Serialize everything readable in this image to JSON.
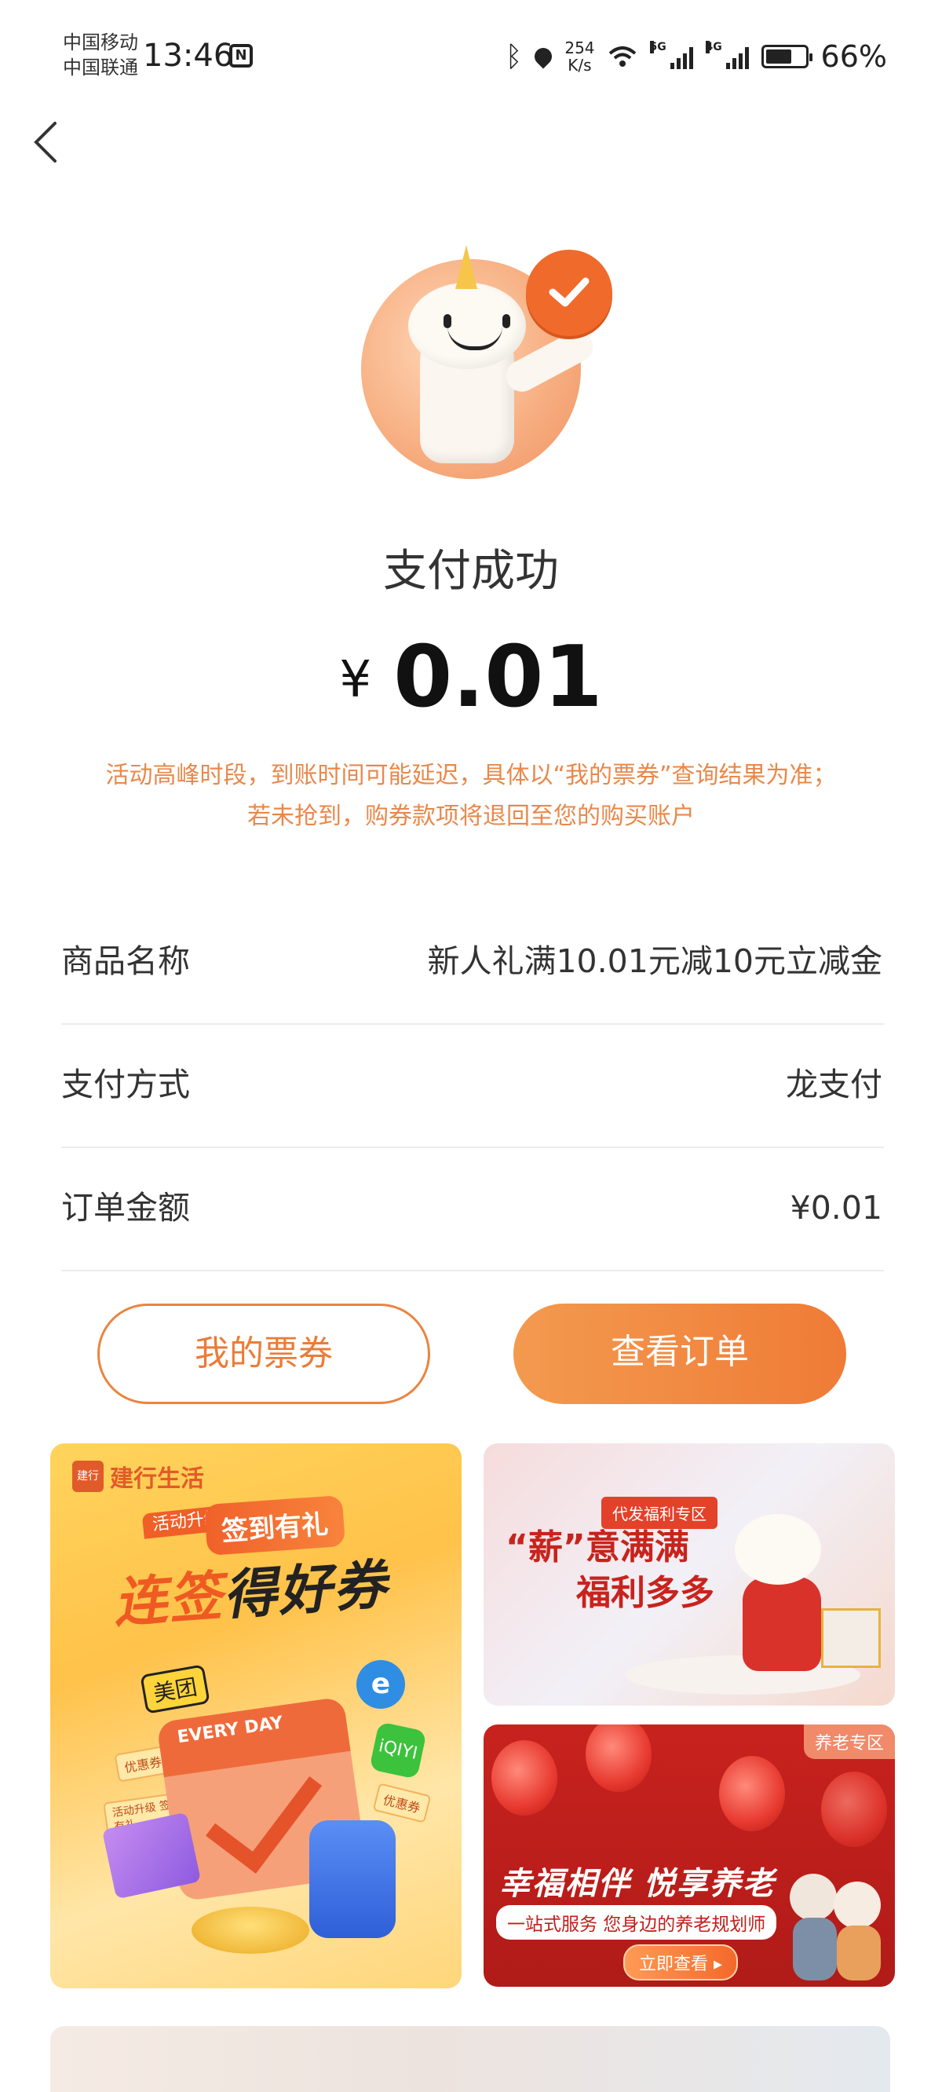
{
  "status_bar": {
    "carrier_1": "中国移动",
    "carrier_2": "中国联通",
    "time": "13:46",
    "nfc": "N",
    "net_speed_value": "254",
    "net_speed_unit": "K/s",
    "sig_1_tag": "5G",
    "sig_2_tag": "4G",
    "battery": "66%"
  },
  "result": {
    "title": "支付成功",
    "currency": "¥",
    "amount": "0.01",
    "notice_line1": "活动高峰时段，到账时间可能延迟，具体以“我的票券”查询结果为准；",
    "notice_line2": "若未抢到，购券款项将退回至您的购买账户"
  },
  "details": [
    {
      "label": "商品名称",
      "value": "新人礼满10.01元减10元立减金"
    },
    {
      "label": "支付方式",
      "value": "龙支付"
    },
    {
      "label": "订单金额",
      "value": "¥0.01"
    }
  ],
  "actions": {
    "my_tickets": "我的票券",
    "view_order": "查看订单"
  },
  "banners": {
    "signin": {
      "brand": "建行生活",
      "logo_text": "建行",
      "tag": "活动升级",
      "sub": "签到有礼",
      "head_1": "连签",
      "head_2": "得好券",
      "meituan": "美团",
      "calendar": "EVERY DAY",
      "e_icon": "e",
      "iqiyi": "iQIYI",
      "ticket_1": "优惠券",
      "ticket_2": "优惠券",
      "ticket_3": "活动升级 签到有礼"
    },
    "salary": {
      "tag": "代发福利专区",
      "head_1": "“薪”意满满",
      "head_2": "福利多多"
    },
    "elder": {
      "tag": "养老专区",
      "head": "幸福相伴 悦享养老",
      "sub": "一站式服务 您身边的养老规划师",
      "button": "立即查看 ▸"
    }
  },
  "colors": {
    "accent": "#ef7b36",
    "notice": "#e9884a",
    "text": "#333333"
  }
}
